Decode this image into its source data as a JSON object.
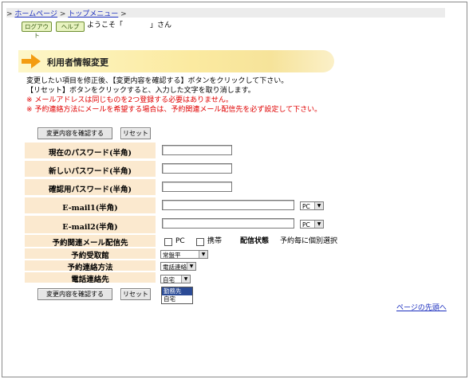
{
  "breadcrumb": {
    "home": "ホームページ",
    "topmenu": "トップメニュー",
    "sep": ">"
  },
  "header": {
    "logout": "ログアウト",
    "help": "ヘルプ",
    "welcome": "ようこそ「",
    "name_suffix": "」さん"
  },
  "title": "利用者情報変更",
  "messages": {
    "line1": "変更したい項目を修正後、【変更内容を確認する】ボタンをクリックして下さい。",
    "line2": "【リセット】ボタンをクリックすると、入力した文字を取り消します。",
    "note1": "※ メールアドレスは同じものを2つ登録する必要はありません。",
    "note2": "※ 予約連絡方法にメールを希望する場合は、予約関連メール配信先を必ず設定して下さい。"
  },
  "buttons": {
    "confirm": "変更内容を確認する",
    "reset": "リセット"
  },
  "form": {
    "current_password": "現在のパスワード(半角)",
    "new_password": "新しいパスワード(半角)",
    "confirm_password": "確認用パスワード(半角)",
    "email1": "E-mail1(半角)",
    "email2": "E-mail2(半角)",
    "email_type1": "PC",
    "email_type2": "PC",
    "mail_dest_label": "予約関連メール配信先",
    "mail_dest_pc": "PC",
    "mail_dest_mobile": "携帯",
    "delivery_status_label": "配信状態",
    "delivery_status_value": "予約毎に個別選択",
    "pickup_label": "予約受取館",
    "pickup_value": "常盤平",
    "contact_method_label": "予約連絡方法",
    "contact_method_value": "電話連絡",
    "phone_label": "電話連絡先",
    "phone_value": "自宅",
    "phone_options": [
      "勤務先",
      "自宅"
    ]
  },
  "footer": {
    "page_top": "ページの先頭へ"
  }
}
